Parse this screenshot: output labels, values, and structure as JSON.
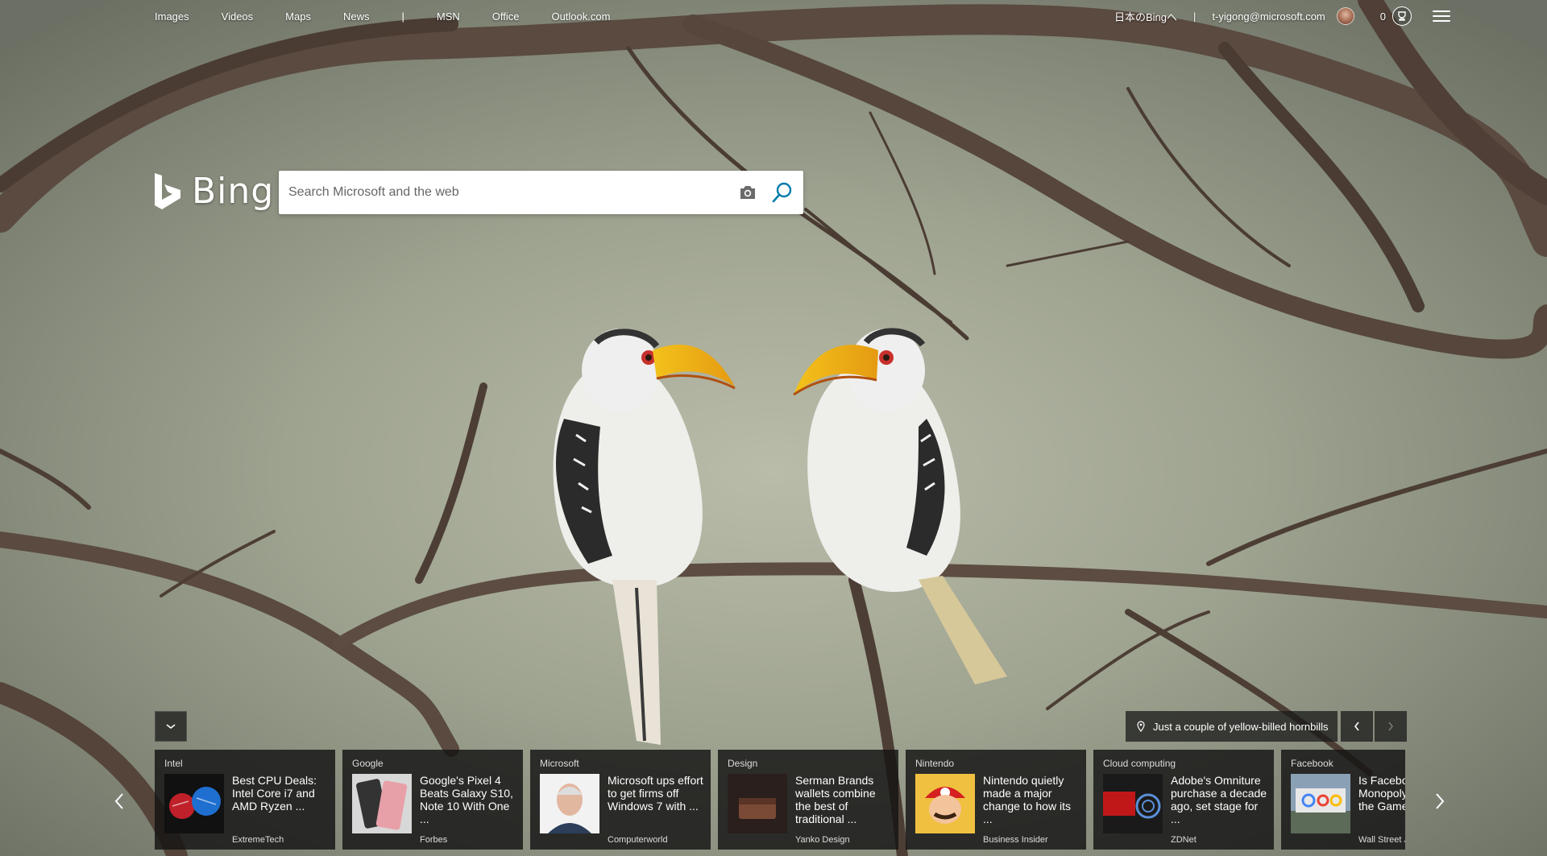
{
  "nav": {
    "left": [
      "Images",
      "Videos",
      "Maps",
      "News"
    ],
    "right": [
      "MSN",
      "Office",
      "Outlook.com"
    ],
    "separator": "|"
  },
  "account": {
    "japan_link": "日本のBingへ",
    "separator": "|",
    "email": "t-yigong@microsoft.com",
    "rewards_count": "0"
  },
  "brand": {
    "name": "Bing"
  },
  "search": {
    "placeholder": "Search Microsoft and the web"
  },
  "image_caption": "Just a couple of yellow-billed hornbills",
  "news": [
    {
      "category": "Intel",
      "headline": "Best CPU Deals: Intel Core i7 and AMD Ryzen ...",
      "source": "ExtremeTech",
      "thumb": "cpu-icon"
    },
    {
      "category": "Google",
      "headline": "Google's Pixel 4 Beats Galaxy S10, Note 10 With One ...",
      "source": "Forbes",
      "thumb": "phone-icon"
    },
    {
      "category": "Microsoft",
      "headline": "Microsoft ups effort to get firms off Windows 7 with ...",
      "source": "Computerworld",
      "thumb": "portrait-icon"
    },
    {
      "category": "Design",
      "headline": "Serman Brands wallets combine the best of traditional ...",
      "source": "Yanko Design",
      "thumb": "wallet-icon"
    },
    {
      "category": "Nintendo",
      "headline": "Nintendo quietly made a major change to how its ...",
      "source": "Business Insider",
      "thumb": "mario-icon"
    },
    {
      "category": "Cloud computing",
      "headline": "Adobe's Omniture purchase a decade ago, set stage for ...",
      "source": "ZDNet",
      "thumb": "cloud-icon"
    },
    {
      "category": "Facebook",
      "headline": "Is Facebook a Monopoly Winning the Game?",
      "source": "Wall Street J",
      "thumb": "google-sign-icon"
    }
  ]
}
